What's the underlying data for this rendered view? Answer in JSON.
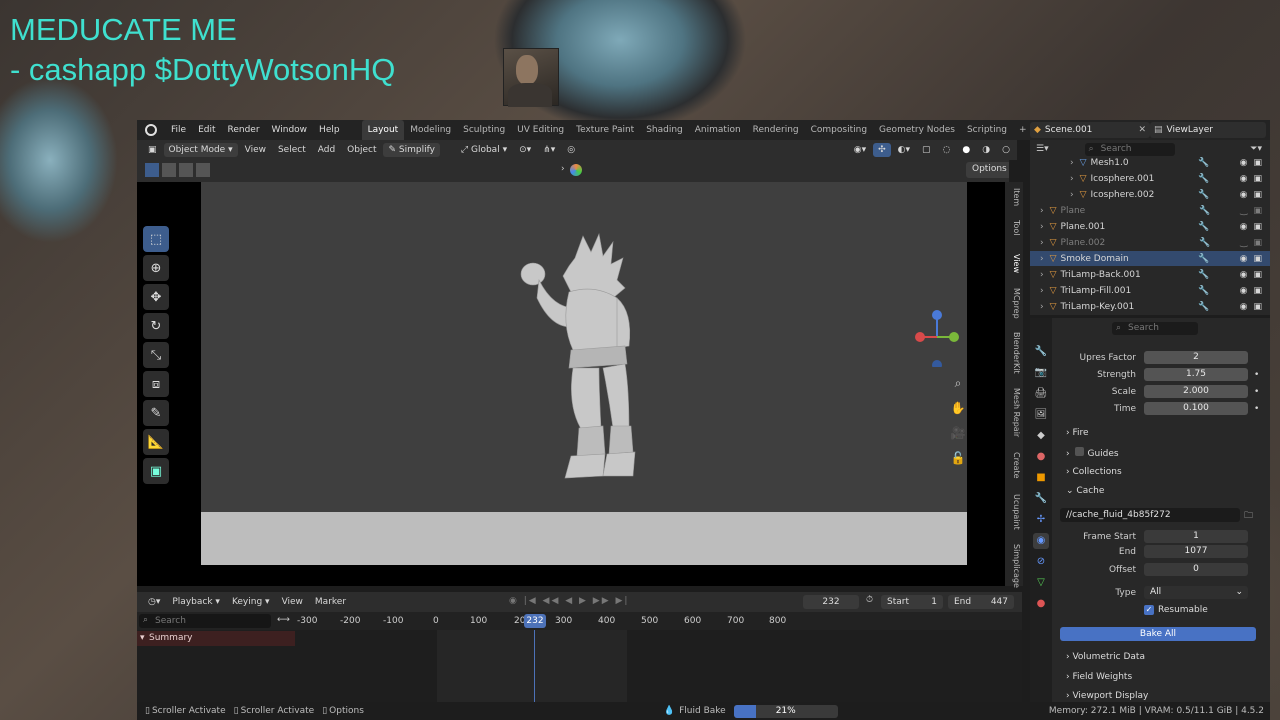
{
  "overlay": {
    "line1": "MEDUCATE ME",
    "line2": "- cashapp $DottyWotsonHQ"
  },
  "menu": [
    "File",
    "Edit",
    "Render",
    "Window",
    "Help"
  ],
  "workspaces": [
    "Layout",
    "Modeling",
    "Sculpting",
    "UV Editing",
    "Texture Paint",
    "Shading",
    "Animation",
    "Rendering",
    "Compositing",
    "Geometry Nodes",
    "Scripting"
  ],
  "scene": "Scene.001",
  "view_layer": "ViewLayer",
  "viewport_header": {
    "mode": "Object Mode",
    "view": "View",
    "select": "Select",
    "add": "Add",
    "object": "Object",
    "simplify": "Simplify",
    "orientation": "Global",
    "options": "Options"
  },
  "npanel_tabs": [
    "Item",
    "Tool",
    "View",
    "MCprep",
    "BlenderKit",
    "Mesh Repair",
    "Create",
    "Ucupaint",
    "Simplicage"
  ],
  "timeline": {
    "playback": "Playback",
    "keying": "Keying",
    "view": "View",
    "marker": "Marker",
    "current_frame": "232",
    "start_label": "Start",
    "start": "1",
    "end_label": "End",
    "end": "447",
    "search_placeholder": "Search",
    "summary": "Summary",
    "ruler": [
      "-300",
      "-200",
      "-100",
      "0",
      "100",
      "20",
      "300",
      "400",
      "500",
      "600",
      "700",
      "800"
    ],
    "indicator": "232"
  },
  "status": {
    "left1": "Scroller Activate",
    "left2": "Scroller Activate",
    "left3": "Options",
    "job": "Fluid Bake",
    "progress_text": "21%",
    "progress": 0.21,
    "memory": "Memory: 272.1 MiB | VRAM: 0.5/11.1 GiB | 4.5.2"
  },
  "outliner": {
    "search_placeholder": "Search",
    "rows": [
      {
        "name": "Mesh1.0",
        "dim": false,
        "selected": false
      },
      {
        "name": "Icosphere.001",
        "dim": false,
        "selected": false
      },
      {
        "name": "Icosphere.002",
        "dim": false,
        "selected": false
      },
      {
        "name": "Plane",
        "dim": true,
        "selected": false
      },
      {
        "name": "Plane.001",
        "dim": false,
        "selected": false
      },
      {
        "name": "Plane.002",
        "dim": true,
        "selected": false
      },
      {
        "name": "Smoke Domain",
        "dim": false,
        "selected": true
      },
      {
        "name": "TriLamp-Back.001",
        "dim": false,
        "selected": false
      },
      {
        "name": "TriLamp-Fill.001",
        "dim": false,
        "selected": false
      },
      {
        "name": "TriLamp-Key.001",
        "dim": false,
        "selected": false
      }
    ]
  },
  "properties": {
    "search_placeholder": "Search",
    "upres_factor_label": "Upres Factor",
    "upres_factor": "2",
    "strength_label": "Strength",
    "strength": "1.75",
    "scale_label": "Scale",
    "scale": "2.000",
    "time_label": "Time",
    "time": "0.100",
    "fire": "Fire",
    "guides": "Guides",
    "collections": "Collections",
    "cache": "Cache",
    "cache_path": "//cache_fluid_4b85f272",
    "frame_start_label": "Frame Start",
    "frame_start": "1",
    "end_label": "End",
    "end": "1077",
    "offset_label": "Offset",
    "offset": "0",
    "type_label": "Type",
    "type": "All",
    "resumable": "Resumable",
    "bake_all": "Bake All",
    "volumetric_data": "Volumetric Data",
    "field_weights": "Field Weights",
    "viewport_display": "Viewport Display"
  },
  "colors": {
    "overlay_text": "#3fe0cf",
    "accent_blue": "#4872c4",
    "selection": "#334a6e"
  }
}
